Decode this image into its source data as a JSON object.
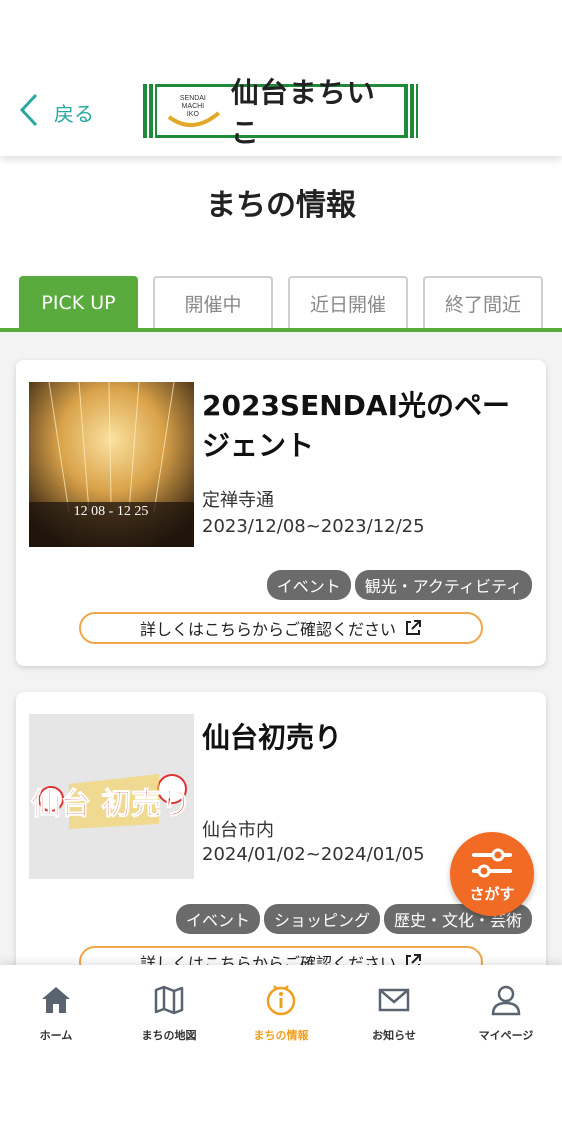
{
  "header": {
    "back_label": "戻る",
    "logo_small": "SENDAI MACHI IKO",
    "logo_text": "仙台まちいこ"
  },
  "page_title": "まちの情報",
  "tabs": [
    {
      "label": "PICK UP",
      "active": true
    },
    {
      "label": "開催中",
      "active": false
    },
    {
      "label": "近日開催",
      "active": false
    },
    {
      "label": "終了間近",
      "active": false
    }
  ],
  "cards": [
    {
      "title": "2023SENDAI光のページェント",
      "place": "定禅寺通",
      "date": "2023/12/08~2023/12/25",
      "tags": [
        "イベント",
        "観光・アクティビティ"
      ],
      "detail_label": "詳しくはこちらからご確認ください",
      "image_text": "12 08 - 12 25"
    },
    {
      "title": "仙台初売り",
      "place": "仙台市内",
      "date": "2024/01/02~2024/01/05",
      "tags": [
        "イベント",
        "ショッピング",
        "歴史・文化・芸術"
      ],
      "detail_label": "詳しくはこちらからご確認ください",
      "image_text": "仙台 初売り"
    }
  ],
  "fab": {
    "label": "さがす",
    "color": "#f26b25"
  },
  "bottom_nav": [
    {
      "label": "ホーム",
      "icon": "home-icon"
    },
    {
      "label": "まちの地図",
      "icon": "map-icon"
    },
    {
      "label": "まちの情報",
      "icon": "info-icon",
      "active": true
    },
    {
      "label": "お知らせ",
      "icon": "mail-icon"
    },
    {
      "label": "マイページ",
      "icon": "user-icon"
    }
  ],
  "colors": {
    "accent_green": "#5aab3d",
    "accent_orange": "#f0a64a",
    "active_nav": "#f0a020",
    "back_teal": "#2aa7a0"
  }
}
